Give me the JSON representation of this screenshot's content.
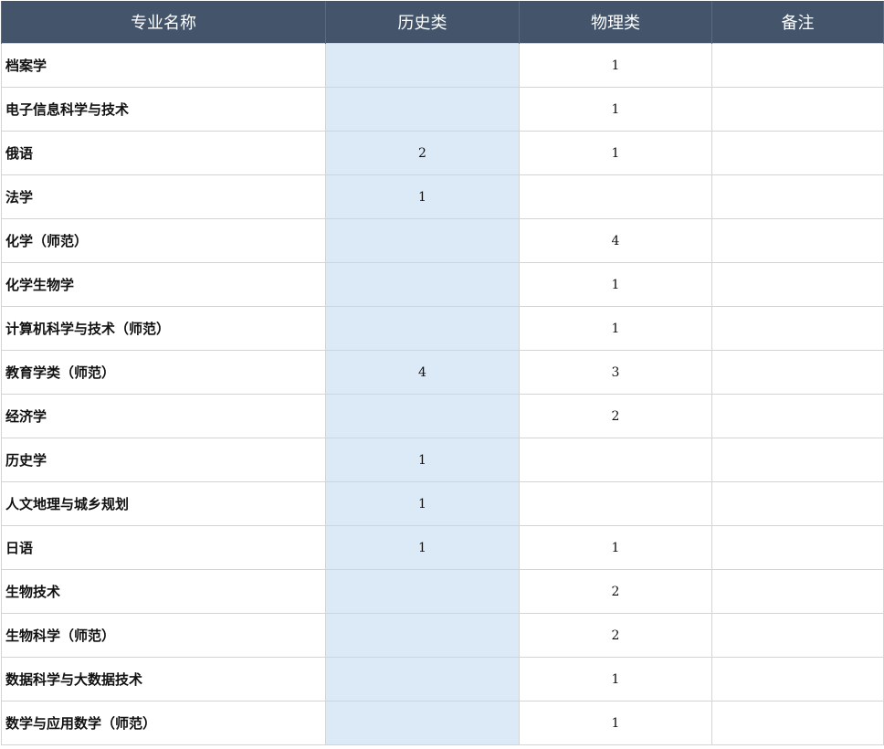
{
  "header": {
    "col_major": "专业名称",
    "col_history": "历史类",
    "col_physics": "物理类",
    "col_note": "备注"
  },
  "rows": [
    {
      "major": "档案学",
      "history": "",
      "physics": "1",
      "note": ""
    },
    {
      "major": "电子信息科学与技术",
      "history": "",
      "physics": "1",
      "note": ""
    },
    {
      "major": "俄语",
      "history": "2",
      "physics": "1",
      "note": ""
    },
    {
      "major": "法学",
      "history": "1",
      "physics": "",
      "note": ""
    },
    {
      "major": "化学（师范）",
      "history": "",
      "physics": "4",
      "note": ""
    },
    {
      "major": "化学生物学",
      "history": "",
      "physics": "1",
      "note": ""
    },
    {
      "major": "计算机科学与技术（师范）",
      "history": "",
      "physics": "1",
      "note": ""
    },
    {
      "major": "教育学类（师范）",
      "history": "4",
      "physics": "3",
      "note": ""
    },
    {
      "major": "经济学",
      "history": "",
      "physics": "2",
      "note": ""
    },
    {
      "major": "历史学",
      "history": "1",
      "physics": "",
      "note": ""
    },
    {
      "major": "人文地理与城乡规划",
      "history": "1",
      "physics": "",
      "note": ""
    },
    {
      "major": "日语",
      "history": "1",
      "physics": "1",
      "note": ""
    },
    {
      "major": "生物技术",
      "history": "",
      "physics": "2",
      "note": ""
    },
    {
      "major": "生物科学（师范）",
      "history": "",
      "physics": "2",
      "note": ""
    },
    {
      "major": "数据科学与大数据技术",
      "history": "",
      "physics": "1",
      "note": ""
    },
    {
      "major": "数学与应用数学（师范）",
      "history": "",
      "physics": "1",
      "note": ""
    }
  ],
  "colors": {
    "header_bg": "#44546a",
    "header_text": "#ffffff",
    "history_column_bg": "#dce9f6",
    "grid_line": "#d4d4d4"
  }
}
